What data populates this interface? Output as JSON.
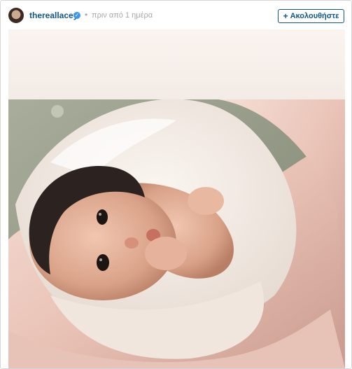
{
  "post": {
    "username": "thereallacey",
    "verified_badge": "check-icon",
    "separator": "•",
    "timestamp": "πριν από 1 ημέρα",
    "follow_button": {
      "plus": "+",
      "label": "Ακολουθήστε"
    }
  },
  "image": {
    "description_icon": "photo-icon"
  },
  "colors": {
    "username": "#125688",
    "verified": "#3897f0",
    "meta": "#a5a7aa",
    "border": "#d6d6d6"
  }
}
